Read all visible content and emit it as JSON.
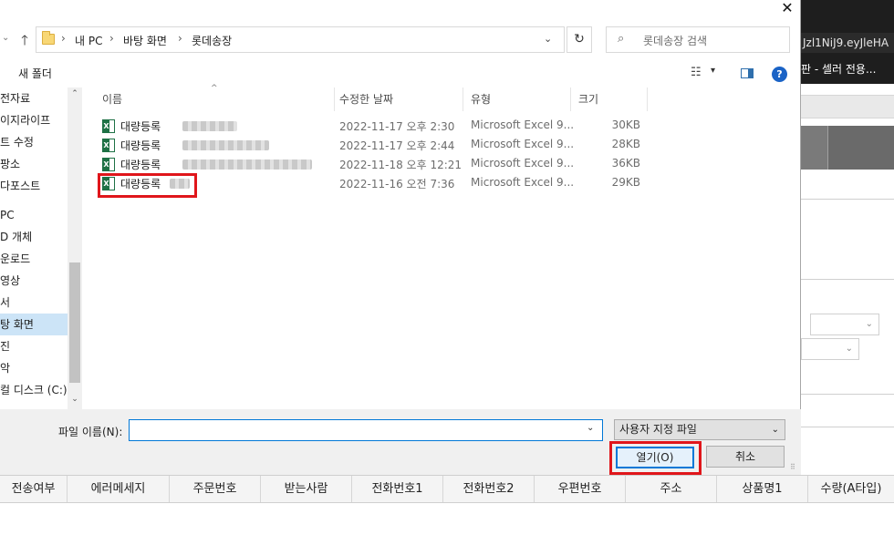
{
  "background": {
    "url_text": "Jzl1NiJ9.eyJleHA",
    "tab_title": "판 - 셀러 전용...",
    "table_headers": [
      "전송여부",
      "에러메세지",
      "주문번호",
      "받는사람",
      "전화번호1",
      "전화번호2",
      "우편번호",
      "주소",
      "상품명1",
      "수량(A타입)"
    ]
  },
  "dialog": {
    "close_glyph": "✕",
    "address": {
      "crumbs": [
        "내 PC",
        "바탕 화면",
        "롯데송장"
      ],
      "separator": "›",
      "refresh_glyph": "↻",
      "up_glyph": "🡑",
      "dropdown_glyph": "⌄"
    },
    "search": {
      "placeholder": "롯데송장 검색",
      "icon": "⌕"
    },
    "toolbar": {
      "new_folder": "새 폴더",
      "view_icon": "☷",
      "dropdown": "▾",
      "help": "?"
    },
    "sidebar": {
      "items": [
        "전자료",
        "이지라이프",
        "트 수정",
        "팡소",
        "다포스트",
        "",
        "PC",
        "D 개체",
        "운로드",
        "영상",
        "서",
        "탕 화면",
        "진",
        "악",
        "컬 디스크 (C:)"
      ],
      "selected_index": 11
    },
    "columns": {
      "name": "이름",
      "date": "수정한 날짜",
      "type": "유형",
      "size": "크기"
    },
    "files": [
      {
        "name": "대량등록",
        "date": "2022-11-17 오후 2:30",
        "type": "Microsoft Excel 9...",
        "size": "30KB"
      },
      {
        "name": "대량등록",
        "date": "2022-11-17 오후 2:44",
        "type": "Microsoft Excel 9...",
        "size": "28KB"
      },
      {
        "name": "대량등록",
        "date": "2022-11-18 오후 12:21",
        "type": "Microsoft Excel 9...",
        "size": "36KB"
      },
      {
        "name": "대량등록",
        "date": "2022-11-16 오전 7:36",
        "type": "Microsoft Excel 9...",
        "size": "29KB"
      }
    ],
    "bottom": {
      "filename_label": "파일 이름(N):",
      "filename_value": "",
      "filetype": "사용자 지정 파일",
      "open_label": "열기(O)",
      "cancel_label": "취소"
    }
  },
  "colors": {
    "highlight": "#e0161b",
    "accent": "#0078d7",
    "selected": "#cce4f7",
    "excel": "#1e7145"
  }
}
